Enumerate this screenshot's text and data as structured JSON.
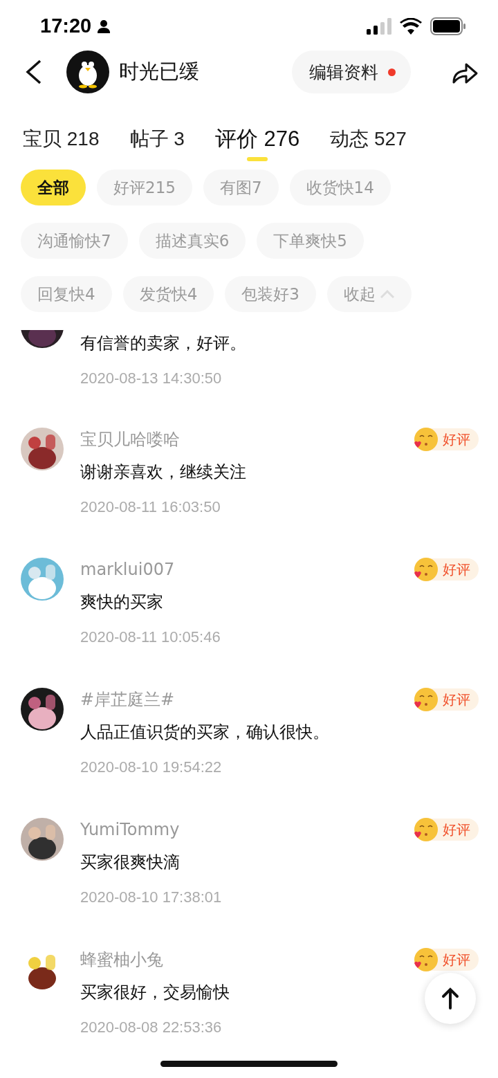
{
  "status_bar": {
    "time": "17:20"
  },
  "header": {
    "name": "时光已缓",
    "edit_button": {
      "label": "编辑资料",
      "dot": true
    }
  },
  "tabs": [
    {
      "label": "宝贝 218",
      "selected": false
    },
    {
      "label": "帖子 3",
      "selected": false
    },
    {
      "label": "评价 276",
      "selected": true
    },
    {
      "label": "动态 527",
      "selected": false
    }
  ],
  "filters": [
    {
      "kind": "filter",
      "label": "全部",
      "selected": true
    },
    {
      "kind": "filter",
      "label": "好评215",
      "selected": false
    },
    {
      "kind": "filter",
      "label": "有图7",
      "selected": false
    },
    {
      "kind": "filter",
      "label": "收货快14",
      "selected": false
    },
    {
      "kind": "filter",
      "label": "沟通愉快7",
      "selected": false
    },
    {
      "kind": "filter",
      "label": "描述真实6",
      "selected": false
    },
    {
      "kind": "filter",
      "label": "下单爽快5",
      "selected": false
    },
    {
      "kind": "filter",
      "label": "回复快4",
      "selected": false
    },
    {
      "kind": "filter",
      "label": "发货快4",
      "selected": false
    },
    {
      "kind": "filter",
      "label": "包装好3",
      "selected": false
    },
    {
      "kind": "collapse",
      "label": "收起",
      "selected": false
    }
  ],
  "reviews": [
    {
      "kind": "partial",
      "text": "有信誉的卖家，好评。",
      "date": "2020-08-13 14:30:50"
    },
    {
      "kind": "full",
      "name": "宝贝儿哈喽哈",
      "text": "谢谢亲喜欢，继续关注",
      "date": "2020-08-11 16:03:50",
      "badge": "好评"
    },
    {
      "kind": "full",
      "name": "marklui007",
      "text": "爽快的买家",
      "date": "2020-08-11 10:05:46",
      "badge": "好评"
    },
    {
      "kind": "full",
      "name": "#岸芷庭兰#",
      "text": "人品正值识货的买家，确认很快。",
      "date": "2020-08-10 19:54:22",
      "badge": "好评"
    },
    {
      "kind": "full",
      "name": "YumiTommy",
      "text": "买家很爽快滴",
      "date": "2020-08-10 17:38:01",
      "badge": "好评"
    },
    {
      "kind": "full",
      "name": "蜂蜜柚小兔",
      "text": "买家很好，交易愉快",
      "date": "2020-08-08 22:53:36",
      "badge": "好评"
    }
  ]
}
